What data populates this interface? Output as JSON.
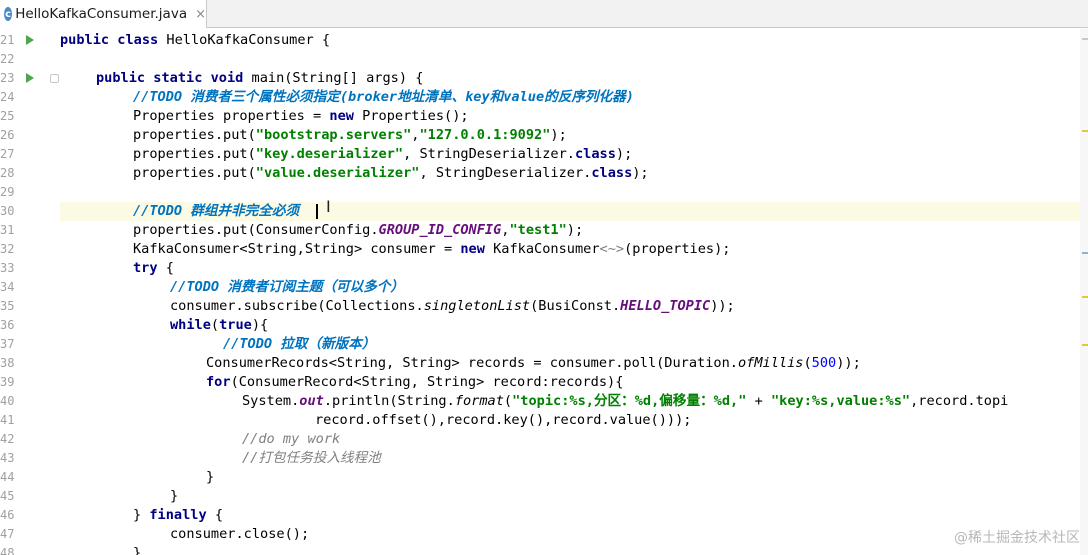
{
  "tab": {
    "icon_letter": "c",
    "title": "HelloKafkaConsumer.java",
    "close": "×"
  },
  "watermark": "@稀土掘金技术社区",
  "code": {
    "l21": {
      "num": "21",
      "kw1": "public class",
      "rest": " HelloKafkaConsumer {"
    },
    "l22": {
      "num": "22"
    },
    "l23": {
      "num": "23",
      "kw1": "public static void",
      "rest": " main(String[] args) {"
    },
    "l24": {
      "num": "24",
      "todo": "//TODO 消费者三个属性必须指定(broker地址清单、key和value的反序列化器)"
    },
    "l25": {
      "num": "25",
      "a": "Properties properties = ",
      "kw": "new",
      "b": " Properties();"
    },
    "l26": {
      "num": "26",
      "a": "properties.put(",
      "s1": "\"bootstrap.servers\"",
      "c": ",",
      "s2": "\"127.0.0.1:9092\"",
      "d": ");"
    },
    "l27": {
      "num": "27",
      "a": "properties.put(",
      "s1": "\"key.deserializer\"",
      "c": ", StringDeserializer.",
      "kw": "class",
      "d": ");"
    },
    "l28": {
      "num": "28",
      "a": "properties.put(",
      "s1": "\"value.deserializer\"",
      "c": ", StringDeserializer.",
      "kw": "class",
      "d": ");"
    },
    "l29": {
      "num": "29"
    },
    "l30": {
      "num": "30",
      "todo": "//TODO 群组并非完全必须"
    },
    "l31": {
      "num": "31",
      "a": "properties.put(ConsumerConfig.",
      "const": "GROUP_ID_CONFIG",
      "c": ",",
      "s1": "\"test1\"",
      "d": ");"
    },
    "l32": {
      "num": "32",
      "a": "KafkaConsumer<String,String> consumer = ",
      "kw": "new",
      "b": " KafkaConsumer",
      "gen": "<~>",
      "d": "(properties);"
    },
    "l33": {
      "num": "33",
      "kw": "try",
      "b": " {"
    },
    "l34": {
      "num": "34",
      "todo": "//TODO 消费者订阅主题（可以多个）"
    },
    "l35": {
      "num": "35",
      "a": "consumer.subscribe(Collections.",
      "it": "singletonList",
      "c": "(BusiConst.",
      "const": "HELLO_TOPIC",
      "d": "));"
    },
    "l36": {
      "num": "36",
      "kw": "while",
      "a": "(",
      "kw2": "true",
      "d": "){"
    },
    "l37": {
      "num": "37",
      "todo": "//TODO 拉取（新版本）"
    },
    "l38": {
      "num": "38",
      "a": "ConsumerRecords<String, String> records = consumer.poll(Duration.",
      "it": "ofMillis",
      "c": "(",
      "n": "500",
      "d": "));"
    },
    "l39": {
      "num": "39",
      "kw": "for",
      "d": "(ConsumerRecord<String, String> record:records){"
    },
    "l40": {
      "num": "40",
      "a": "System.",
      "const": "out",
      "b": ".println(String.",
      "it": "format",
      "c": "(",
      "s1": "\"topic:%s,分区：%d,偏移量：%d,\"",
      "d": " + ",
      "s2": "\"key:%s,value:%s\"",
      "e": ",record.topi"
    },
    "l41": {
      "num": "41",
      "a": "record.offset(),record.key(),record.value()));"
    },
    "l42": {
      "num": "42",
      "cm": "//do my work"
    },
    "l43": {
      "num": "43",
      "cm": "//打包任务投入线程池"
    },
    "l44": {
      "num": "44",
      "a": "}"
    },
    "l45": {
      "num": "45",
      "a": "}"
    },
    "l46": {
      "num": "46",
      "a": "} ",
      "kw": "finally",
      "b": " {"
    },
    "l47": {
      "num": "47",
      "a": "consumer.close();"
    },
    "l48": {
      "num": "48",
      "a": "}"
    }
  },
  "colors": {
    "keyword": "#000080",
    "string": "#008000",
    "todo": "#0073bf",
    "comment": "#808080",
    "constant": "#660e7a",
    "number": "#0000ff",
    "current_line": "#fcfae3",
    "run_icon": "#4ea54b"
  },
  "icons": {
    "run": "run-arrow-icon",
    "fold": "fold-icon",
    "file": "java-class-icon",
    "cursor": "text-cursor-icon"
  }
}
